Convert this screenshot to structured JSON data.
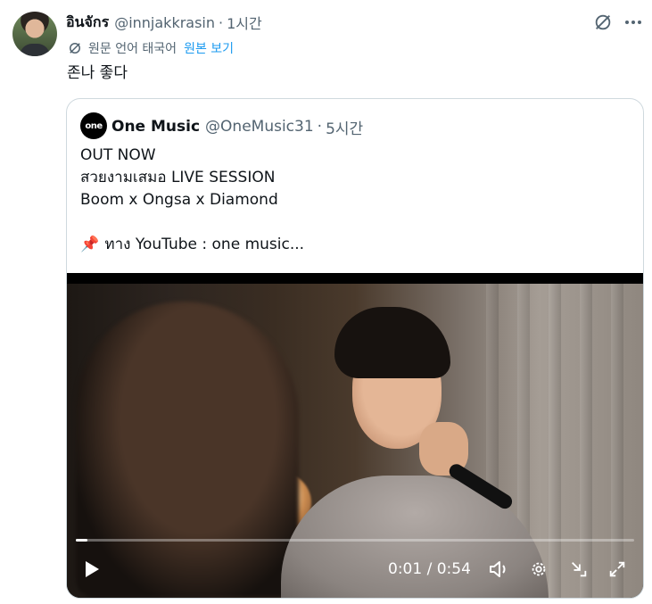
{
  "tweet": {
    "author_name": "อินจักร",
    "handle": "@innjakkrasin",
    "separator": "·",
    "time": "1시간",
    "translate_note": "원문 언어 태국어",
    "show_original": "원본 보기",
    "text": "존나 좋다"
  },
  "quote": {
    "avatar_text": "one",
    "author_name": "One Music",
    "handle": "@OneMusic31",
    "separator": "·",
    "time": "5시간",
    "lines": [
      "OUT NOW",
      "สวยงามเสมอ LIVE SESSION",
      "Boom x Ongsa x Diamond",
      "",
      "ทาง YouTube : one music..."
    ],
    "pin_emoji": "📌"
  },
  "video": {
    "current_time": "0:01",
    "duration": "0:54",
    "timecode": "0:01 / 0:54",
    "progress_fraction": 0.02
  },
  "icons": {
    "grok": "grok-icon",
    "more": "more-icon",
    "translate": "translate-icon",
    "play": "play-icon",
    "volume": "volume-icon",
    "settings": "settings-icon",
    "minimize": "minimize-icon",
    "fullscreen": "fullscreen-icon"
  },
  "colors": {
    "text": "#0f1419",
    "secondary": "#536471",
    "link": "#1d9bf0",
    "border": "#cfd9de"
  }
}
